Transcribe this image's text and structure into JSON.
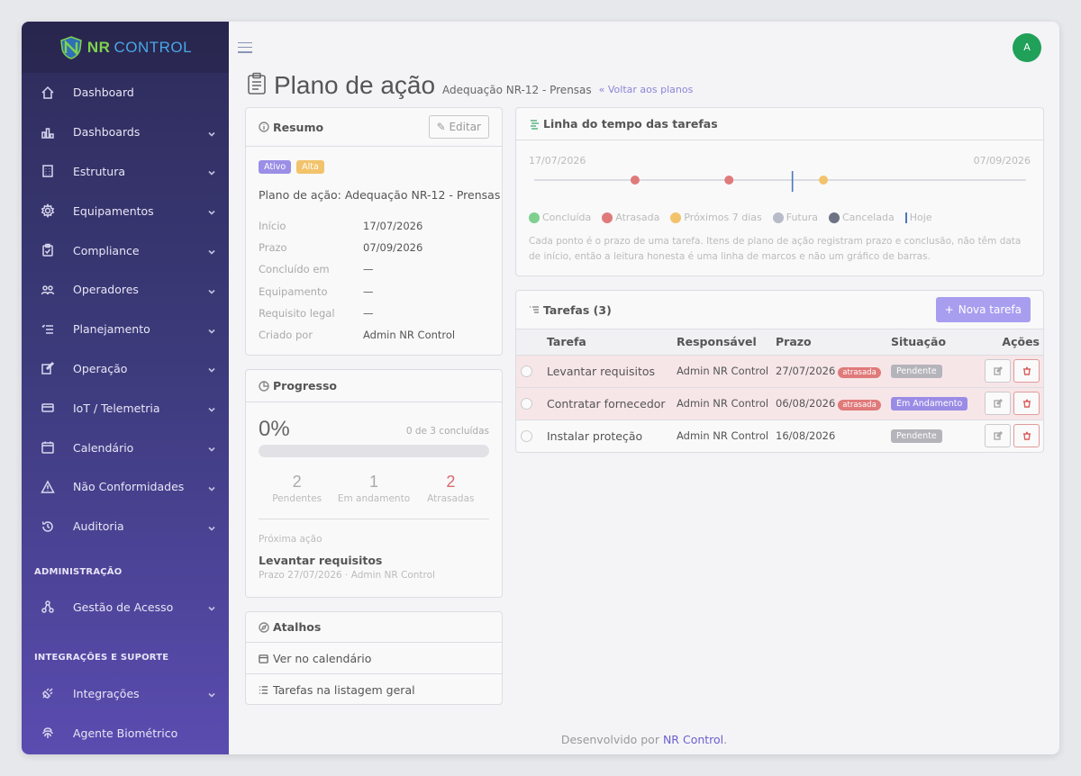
{
  "brand": {
    "nr": "NR",
    "control": "CONTROL"
  },
  "sidebar": {
    "items": [
      {
        "label": "Dashboard",
        "icon": "home-icon"
      },
      {
        "label": "Dashboards",
        "icon": "bar-chart-icon"
      },
      {
        "label": "Estrutura",
        "icon": "building-icon"
      },
      {
        "label": "Equipamentos",
        "icon": "gear-icon"
      },
      {
        "label": "Compliance",
        "icon": "clipboard-check-icon"
      },
      {
        "label": "Operadores",
        "icon": "users-icon"
      },
      {
        "label": "Planejamento",
        "icon": "list-icon"
      },
      {
        "label": "Operação",
        "icon": "edit-icon"
      },
      {
        "label": "IoT / Telemetria",
        "icon": "chip-icon"
      },
      {
        "label": "Calendário",
        "icon": "calendar-icon"
      },
      {
        "label": "Não Conformidades",
        "icon": "warning-icon"
      },
      {
        "label": "Auditoria",
        "icon": "history-icon"
      }
    ],
    "section_admin": "ADMINISTRAÇÃO",
    "admin_items": [
      {
        "label": "Gestão de Acesso",
        "icon": "nodes-icon"
      }
    ],
    "section_integ": "INTEGRAÇÕES E SUPORTE",
    "integ_items": [
      {
        "label": "Integrações",
        "icon": "plug-icon"
      },
      {
        "label": "Agente Biométrico",
        "icon": "fingerprint-icon"
      }
    ]
  },
  "topbar": {
    "avatar": "A"
  },
  "page": {
    "title": "Plano de ação",
    "subtitle": "Adequação NR-12 - Prensas",
    "back": "« Voltar aos planos"
  },
  "resumo": {
    "title": "Resumo",
    "edit": "Editar",
    "badge_status": "Ativo",
    "badge_priority": "Alta",
    "plan_name": "Plano de ação: Adequação NR-12 - Prensas",
    "rows": [
      {
        "k": "Início",
        "v": "17/07/2026"
      },
      {
        "k": "Prazo",
        "v": "07/09/2026"
      },
      {
        "k": "Concluído em",
        "v": "—"
      },
      {
        "k": "Equipamento",
        "v": "—"
      },
      {
        "k": "Requisito legal",
        "v": "—"
      },
      {
        "k": "Criado por",
        "v": "Admin NR Control"
      }
    ]
  },
  "progresso": {
    "title": "Progresso",
    "percent_label": "0%",
    "percent": 0,
    "summary": "0 de 3 concluídas",
    "stats": [
      {
        "n": "2",
        "t": "Pendentes"
      },
      {
        "n": "1",
        "t": "Em andamento"
      },
      {
        "n": "2",
        "t": "Atrasadas"
      }
    ],
    "next_label": "Próxima ação",
    "next_title": "Levantar requisitos",
    "next_meta": "Prazo 27/07/2026 · Admin NR Control"
  },
  "atalhos": {
    "title": "Atalhos",
    "links": [
      "Ver no calendário",
      "Tarefas na listagem geral"
    ]
  },
  "timeline": {
    "title": "Linha do tempo das tarefas",
    "start": "17/07/2026",
    "end": "07/09/2026",
    "legend": [
      {
        "label": "Concluída",
        "color": "#7fcf8e"
      },
      {
        "label": "Atrasada",
        "color": "#e07a7a"
      },
      {
        "label": "Próximos 7 dias",
        "color": "#f2c36b"
      },
      {
        "label": "Futura",
        "color": "#b8bcc8"
      },
      {
        "label": "Cancelada",
        "color": "#6e7384"
      },
      {
        "label": "Hoje",
        "color": "#4a78b8"
      }
    ],
    "note": "Cada ponto é o prazo de uma tarefa. Itens de plano de ação registram prazo e conclusão, não têm data de início, então a leitura honesta é uma linha de marcos e não um gráfico de barras.",
    "markers": [
      {
        "date": "27/07/2026",
        "color": "#e07a7a",
        "frac": 0.205
      },
      {
        "date": "06/08/2026",
        "color": "#e07a7a",
        "frac": 0.396
      },
      {
        "date": "16/08/2026",
        "color": "#f2c36b",
        "frac": 0.588
      }
    ],
    "today_frac": 0.525
  },
  "tarefas": {
    "title": "Tarefas (3)",
    "new_btn": "Nova tarefa",
    "headers": [
      "Tarefa",
      "Responsável",
      "Prazo",
      "Situação",
      "Ações"
    ],
    "rows": [
      {
        "name": "Levantar requisitos",
        "resp": "Admin NR Control",
        "prazo": "27/07/2026",
        "late": "atrasada",
        "sit": "Pendente",
        "sit_class": "pend",
        "row_late": true
      },
      {
        "name": "Contratar fornecedor",
        "resp": "Admin NR Control",
        "prazo": "06/08/2026",
        "late": "atrasada",
        "sit": "Em Andamento",
        "sit_class": "and",
        "row_late": true
      },
      {
        "name": "Instalar proteção",
        "resp": "Admin NR Control",
        "prazo": "16/08/2026",
        "late": "",
        "sit": "Pendente",
        "sit_class": "pend",
        "row_late": false
      }
    ]
  },
  "footer": {
    "prefix": "Desenvolvido por",
    "link": "NR Control",
    "suffix": "."
  }
}
